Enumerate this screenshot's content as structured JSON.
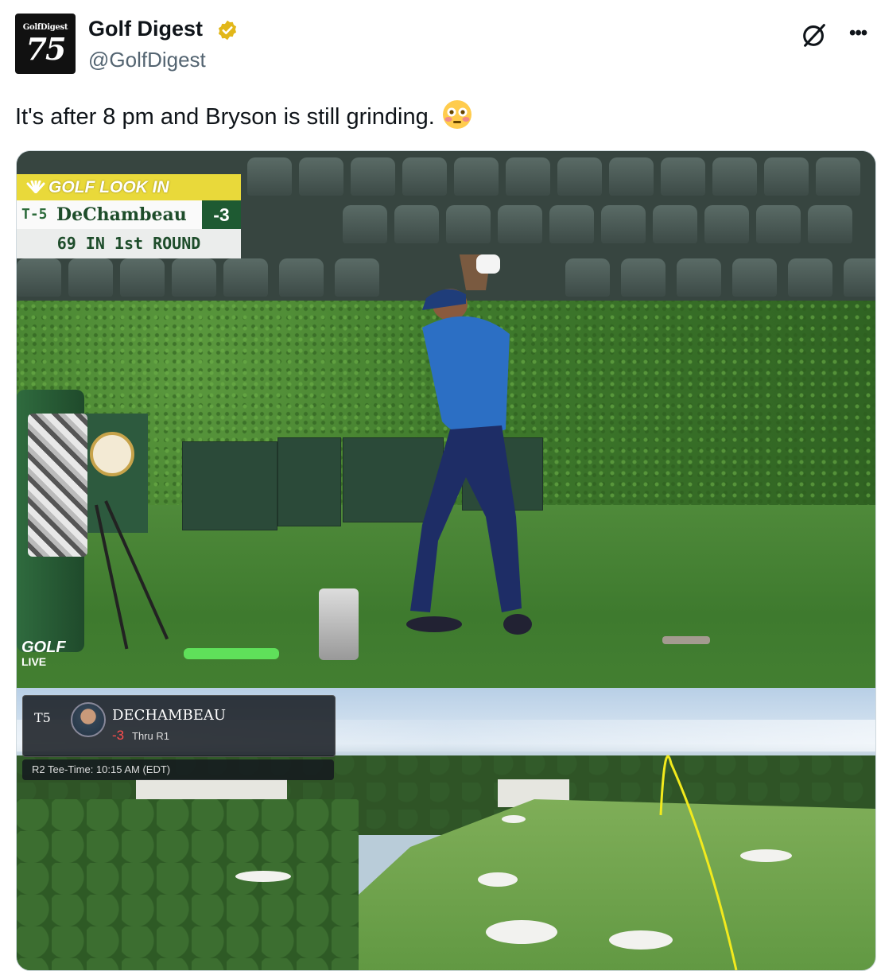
{
  "account": {
    "display_name": "Golf Digest",
    "handle": "@GolfDigest",
    "avatar_brand": "GolfDigest",
    "avatar_number": "75",
    "verified_badge_color": "#e2b719"
  },
  "tweet": {
    "text": "It's after 8 pm and Bryson is still grinding.",
    "emoji": "flushed-face-emoji"
  },
  "media": {
    "broadcast": {
      "banner": "GOLF LOOK IN",
      "position": "T-5",
      "player": "DeChambeau",
      "score": "-3",
      "round_info": "69 IN 1st ROUND",
      "network": "GOLF",
      "network_sub": "LIVE"
    },
    "game_overlay": {
      "position": "T5",
      "player": "DECHAMBEAU",
      "score": "-3",
      "thru": "Thru R1",
      "tee_time": "R2 Tee-Time: 10:15 AM (EDT)"
    }
  },
  "colors": {
    "text_primary": "#0f1419",
    "text_secondary": "#536471",
    "banner_yellow": "#e9d93a",
    "score_green": "#1e5a32",
    "tracer_yellow": "#f2ea1d"
  }
}
